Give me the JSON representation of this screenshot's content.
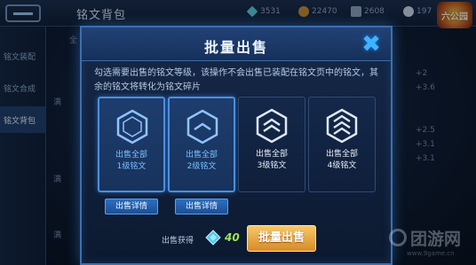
{
  "background": {
    "title": "铭文背包",
    "resources": [
      "3531",
      "22470",
      "2608",
      "197"
    ],
    "logo_text": "六公园",
    "left_nav": [
      "铭文装配",
      "铭文合成",
      "铭文背包"
    ],
    "tab_hint": "全",
    "right_stats": [
      "+2",
      "+3.6",
      "",
      "",
      "+2.5",
      "+3.1",
      "+3.1"
    ],
    "bg_items": [
      "满",
      "满",
      "满"
    ]
  },
  "modal": {
    "title": "批量出售",
    "close_icon": "close-icon",
    "description": "勾选需要出售的铭文等级，该操作不会出售已装配在铭文页中的铭文，其余的铭文将转化为铭文碎片",
    "cards": [
      {
        "line1": "出售全部",
        "line2": "1级铭文",
        "selected": true,
        "stripes": 0
      },
      {
        "line1": "出售全部",
        "line2": "2级铭文",
        "selected": true,
        "stripes": 1
      },
      {
        "line1": "出售全部",
        "line2": "3级铭文",
        "selected": false,
        "stripes": 2
      },
      {
        "line1": "出售全部",
        "line2": "4级铭文",
        "selected": false,
        "stripes": 3
      }
    ],
    "detail_buttons": [
      "出售详情",
      "出售详情"
    ],
    "gain_label": "出售获得",
    "gain_icon": "gem-icon",
    "gain_value": "40",
    "sell_button": "批量出售"
  },
  "watermark": {
    "text": "团游网",
    "url": "www.9game.cn"
  },
  "colors": {
    "accent_blue": "#3fb3ff",
    "sell_button": "#e8a53c",
    "gain_value": "#9fe25a"
  }
}
